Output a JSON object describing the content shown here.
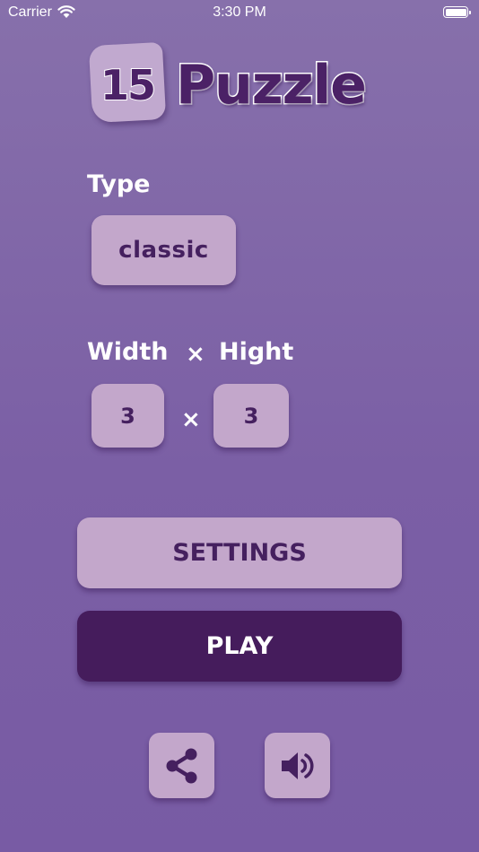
{
  "status_bar": {
    "carrier": "Carrier",
    "time": "3:30 PM",
    "wifi_icon": "wifi-icon",
    "battery_icon": "battery-icon"
  },
  "logo": {
    "number": "15",
    "word": "Puzzle"
  },
  "type": {
    "label": "Type",
    "value": "classic"
  },
  "size": {
    "width_label": "Width",
    "separator": "×",
    "height_label": "Hight",
    "width_value": "3",
    "height_value": "3"
  },
  "buttons": {
    "settings": "SETTINGS",
    "play": "PLAY",
    "share_icon": "share-icon",
    "sound_icon": "speaker-icon"
  },
  "colors": {
    "background_top": "#8770ab",
    "background_bottom": "#785ba4",
    "tile": "#c3a7cb",
    "tile_text": "#45205f",
    "play_bg": "#451c5c",
    "label_text": "#ffffff"
  }
}
